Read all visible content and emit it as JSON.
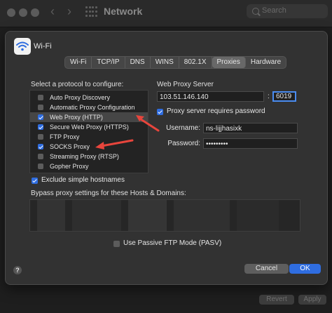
{
  "window": {
    "title": "Network",
    "search_placeholder": "Search"
  },
  "interface": {
    "name": "Wi-Fi"
  },
  "tabs": [
    {
      "label": "Wi-Fi",
      "active": false
    },
    {
      "label": "TCP/IP",
      "active": false
    },
    {
      "label": "DNS",
      "active": false
    },
    {
      "label": "WINS",
      "active": false
    },
    {
      "label": "802.1X",
      "active": false
    },
    {
      "label": "Proxies",
      "active": true
    },
    {
      "label": "Hardware",
      "active": false
    }
  ],
  "protocols": {
    "heading": "Select a protocol to configure:",
    "items": [
      {
        "label": "Auto Proxy Discovery",
        "checked": false,
        "selected": false
      },
      {
        "label": "Automatic Proxy Configuration",
        "checked": false,
        "selected": false
      },
      {
        "label": "Web Proxy (HTTP)",
        "checked": true,
        "selected": true
      },
      {
        "label": "Secure Web Proxy (HTTPS)",
        "checked": true,
        "selected": false
      },
      {
        "label": "FTP Proxy",
        "checked": false,
        "selected": false
      },
      {
        "label": "SOCKS Proxy",
        "checked": true,
        "selected": false
      },
      {
        "label": "Streaming Proxy (RTSP)",
        "checked": false,
        "selected": false
      },
      {
        "label": "Gopher Proxy",
        "checked": false,
        "selected": false
      }
    ]
  },
  "server": {
    "heading": "Web Proxy Server",
    "host": "103.51.146.140",
    "separator": ":",
    "port": "6019",
    "requires_password_label": "Proxy server requires password",
    "requires_password": true,
    "username_label": "Username:",
    "username": "ns-lijjhasixk",
    "password_label": "Password:",
    "password": "•••••••••"
  },
  "exclude_simple_label": "Exclude simple hostnames",
  "bypass_label": "Bypass proxy settings for these Hosts & Domains:",
  "passive_ftp_label": "Use Passive FTP Mode (PASV)",
  "buttons": {
    "help": "?",
    "cancel": "Cancel",
    "ok": "OK"
  },
  "footer": {
    "revert": "Revert",
    "apply": "Apply"
  },
  "colors": {
    "accent": "#2f6de0",
    "annotation": "#e8453c",
    "background": "#1e1e1e",
    "sheet": "#323232"
  }
}
